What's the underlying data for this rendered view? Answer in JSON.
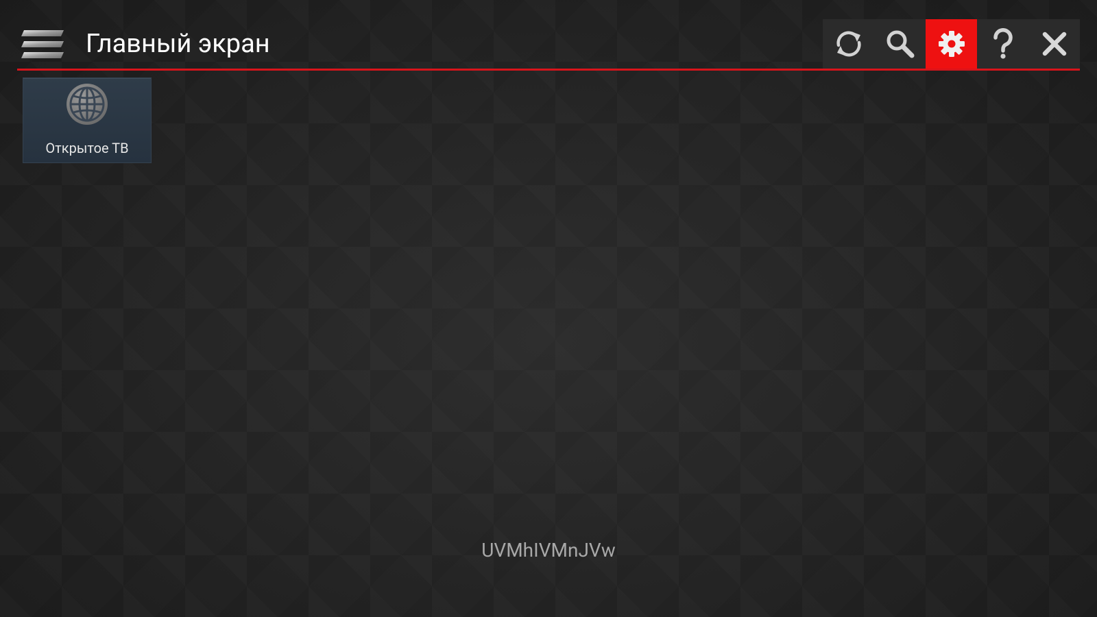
{
  "header": {
    "title": "Главный экран",
    "menu_icon": "menu-icon",
    "accent_color": "#d9141b"
  },
  "toolbar": {
    "buttons": [
      {
        "icon": "refresh-icon",
        "active": false
      },
      {
        "icon": "search-icon",
        "active": false
      },
      {
        "icon": "settings-gear-icon",
        "active": true
      },
      {
        "icon": "help-icon",
        "active": false
      },
      {
        "icon": "close-icon",
        "active": false
      }
    ],
    "active_color": "#ee1111"
  },
  "tiles": [
    {
      "label": "Открытое ТВ",
      "icon": "globe-icon"
    }
  ],
  "footer": {
    "code": "UVMhIVMnJVw"
  }
}
